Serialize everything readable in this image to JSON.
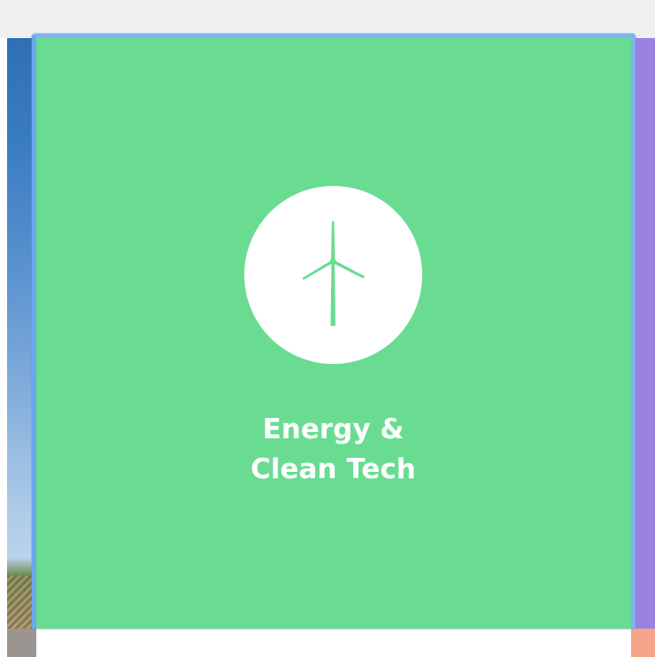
{
  "card": {
    "title_line1": "Energy &",
    "title_line2": "Clean Tech",
    "icon": "wind-turbine-icon",
    "background_color": "#69dc92",
    "icon_circle_color": "#ffffff"
  },
  "neighbors": {
    "left_panel": "photo",
    "right_panel_color": "#9b82e0"
  }
}
